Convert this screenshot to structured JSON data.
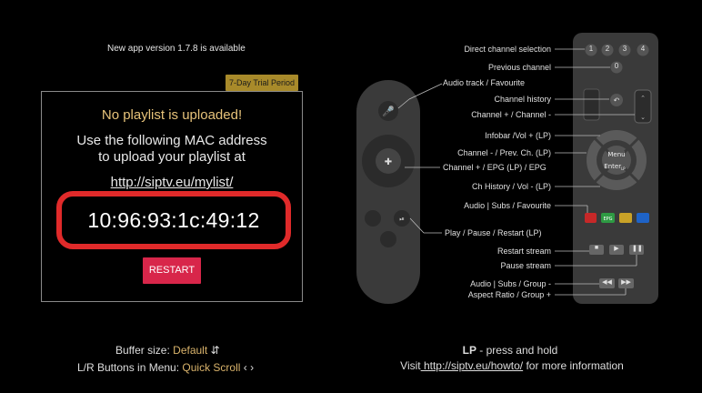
{
  "update_notice": "New app version 1.7.8 is available",
  "trial_badge": "7-Day Trial Period",
  "panel": {
    "title": "No playlist is uploaded!",
    "instruction_line1": "Use the following MAC address",
    "instruction_line2": "to upload your playlist at",
    "url": "http://siptv.eu/mylist/",
    "mac_address": "10:96:93:1c:49:12",
    "restart_label": "RESTART"
  },
  "settings": {
    "buffer_label": "Buffer size:",
    "buffer_value": "Default",
    "lr_label": "L/R Buttons in Menu:",
    "lr_value": "Quick Scroll"
  },
  "help": {
    "lp_bold": "LP",
    "lp_rest": " - press and hold",
    "visit_prefix": "Visit",
    "visit_link": " http://siptv.eu/howto/",
    "visit_suffix": " for more information"
  },
  "remote_small_labels": {
    "audio_track": "Audio track / Favourite",
    "channel_up": "Channel + / EPG (LP) / EPG",
    "play_pause": "Play / Pause / Restart (LP)"
  },
  "remote_large_labels": {
    "direct_channel": "Direct channel selection",
    "previous_channel": "Previous channel",
    "channel_history": "Channel history",
    "channel_plus_minus": "Channel + / Channel -",
    "infobar": "Infobar /Vol + (LP)",
    "channel_minus_prev": "Channel - / Prev. Ch. (LP)",
    "ch_history_vol": "Ch History / Vol - (LP)",
    "audio_subs_fav": "Audio | Subs / Favourite",
    "restart_stream": "Restart stream",
    "pause_stream": "Pause stream",
    "audio_subs_group": "Audio | Subs / Group -",
    "aspect_ratio": "Aspect Ratio / Group +"
  },
  "keypad": [
    "1",
    "2",
    "3",
    "4"
  ],
  "prev_key": "0",
  "menu_key": "Menu",
  "enter_key": "Enter",
  "enter_sub": "LP",
  "epg_key": "EPG",
  "colors": {
    "accent_red": "#e02a2a",
    "restart_bg": "#d8264a",
    "trial_bg": "#a88a2a",
    "title_gold": "#e7c37a"
  }
}
